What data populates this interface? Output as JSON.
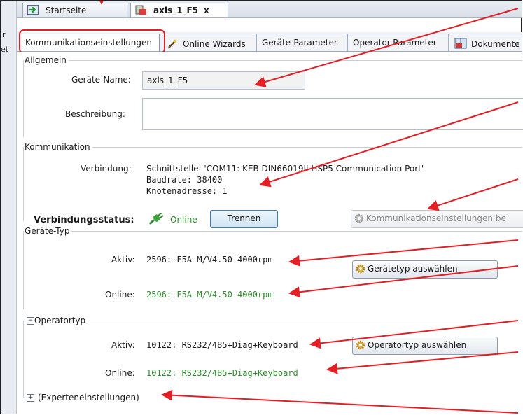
{
  "doc_tabs": [
    {
      "label": "Startseite"
    },
    {
      "label": "axis_1_F5",
      "close": "x"
    }
  ],
  "left_strip": {
    "glyph1": "r",
    "glyph2": "et"
  },
  "sub_tabs": [
    {
      "label": "Kommunikationseinstellungen"
    },
    {
      "label": "Online Wizards"
    },
    {
      "label": "Geräte-Parameter"
    },
    {
      "label": "Operator-Parameter"
    },
    {
      "label": "Dokumente"
    }
  ],
  "allgemein": {
    "legend": "Allgemein",
    "name_label": "Geräte-Name:",
    "name_value": "axis_1_F5",
    "desc_label": "Beschreibung:",
    "desc_value": ""
  },
  "kommunikation": {
    "legend": "Kommunikation",
    "conn_label": "Verbindung:",
    "conn_line1": "Schnittstelle: 'COM11: KEB DIN66019II HSP5 Communication Port'",
    "conn_line2": "Baudrate: 38400",
    "conn_line3": "Knotenadresse: 1",
    "status_label": "Verbindungsstatus:",
    "status_value": "Online",
    "disconnect_button": "Trennen",
    "settings_button": "Kommunikationseinstellungen be"
  },
  "geraete_typ": {
    "legend": "Geräte-Typ",
    "active_label": "Aktiv:",
    "active_value": "2596: F5A-M/V4.50 4000rpm",
    "online_label": "Online:",
    "online_value": "2596: F5A-M/V4.50 4000rpm",
    "select_button": "Gerätetyp auswählen"
  },
  "operatortyp": {
    "expander": "−",
    "legend": "Operatortyp",
    "active_label": "Aktiv:",
    "active_value": "10122: RS232/485+Diag+Keyboard",
    "online_label": "Online:",
    "online_value": "10122: RS232/485+Diag+Keyboard",
    "select_button": "Operatortyp auswählen"
  },
  "experten": {
    "expander": "+",
    "label": "(Experteneinstellungen)"
  },
  "colors": {
    "accent_red": "#e31e24",
    "online_green": "#2f8a2f"
  }
}
